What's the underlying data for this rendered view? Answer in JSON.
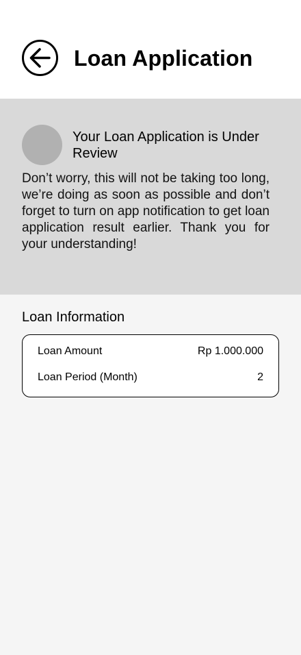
{
  "header": {
    "title": "Loan Application",
    "back_icon": "arrow-left-circle-icon"
  },
  "review": {
    "title": "Your Loan Application is Under Review",
    "message": "Don’t worry, this will not be taking too long, we’re doing as soon as possible and don’t forget to turn on app notification to get loan application result earlier. Thank you for your understanding!"
  },
  "loan_info": {
    "heading": "Loan Information",
    "rows": [
      {
        "label": "Loan Amount",
        "value": "Rp 1.000.000"
      },
      {
        "label": "Loan Period (Month)",
        "value": "2"
      }
    ]
  },
  "colors": {
    "header_bg": "#ffffff",
    "banner_bg": "#d9d9d9",
    "avatar": "#b1b1b1",
    "page_bg": "#f5f5f5",
    "card_bg": "#ffffff"
  }
}
